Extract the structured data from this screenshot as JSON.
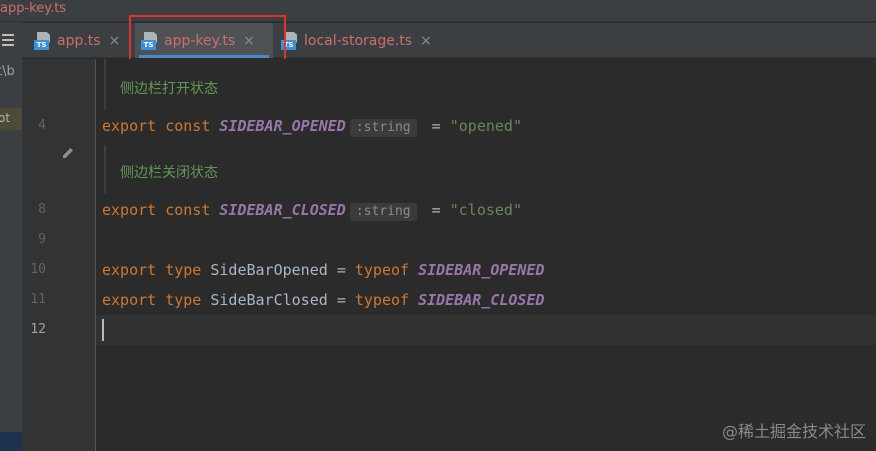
{
  "window": {
    "title": "app-key.ts"
  },
  "left_panel": {
    "path_fragment": "t\\b",
    "highlight_fragment": "ot"
  },
  "tabs": [
    {
      "label": "app.ts",
      "icon": "typescript-file-icon",
      "badge": "TS",
      "close": "×",
      "active": false
    },
    {
      "label": "app-key.ts",
      "icon": "typescript-file-icon",
      "badge": "TS",
      "close": "×",
      "active": true
    },
    {
      "label": "local-storage.ts",
      "icon": "typescript-file-icon",
      "badge": "TS",
      "close": "×",
      "active": false
    }
  ],
  "gutter": {
    "line_numbers": [
      "4",
      "8",
      "9",
      "10",
      "11",
      "12"
    ],
    "current_line": "12",
    "edit_icon": "pencil-icon"
  },
  "editor": {
    "doc_comments": [
      "侧边栏打开状态",
      "侧边栏关闭状态"
    ],
    "lines": [
      {
        "kw1": "export",
        "kw2": "const",
        "name": "SIDEBAR_OPENED",
        "hint": ":string",
        "eq": "=",
        "value": "\"opened\""
      },
      {
        "kw1": "export",
        "kw2": "const",
        "name": "SIDEBAR_CLOSED",
        "hint": ":string",
        "eq": "=",
        "value": "\"closed\""
      },
      {
        "kw1": "export",
        "kw2": "type",
        "name": "SideBarOpened",
        "eq": "=",
        "kw3": "typeof",
        "ref": "SIDEBAR_OPENED"
      },
      {
        "kw1": "export",
        "kw2": "type",
        "name": "SideBarClosed",
        "eq": "=",
        "kw3": "typeof",
        "ref": "SIDEBAR_CLOSED"
      }
    ]
  },
  "watermark": "@稀土掘金技术社区",
  "colors": {
    "keyword": "#cc7832",
    "constant": "#9876aa",
    "string": "#6a8759",
    "doc_comment": "#629755",
    "tab_text": "#cc6e6e",
    "tab_underline": "#4a88c7",
    "annotation_box": "#e03030"
  }
}
